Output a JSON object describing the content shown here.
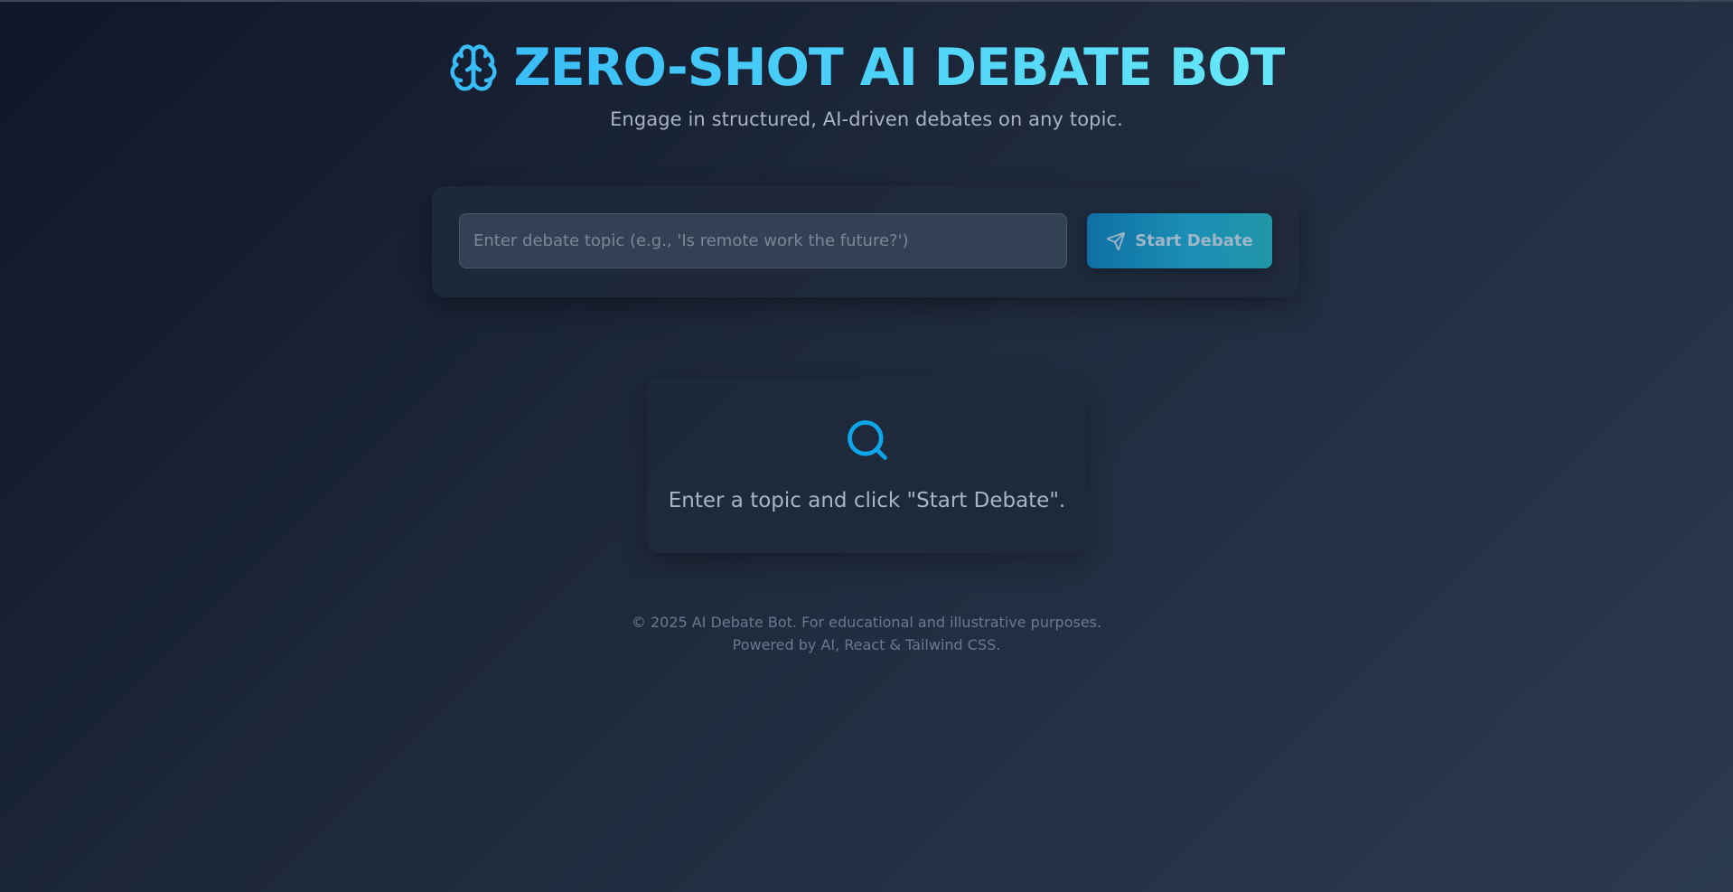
{
  "header": {
    "title": "ZERO-SHOT AI DEBATE BOT",
    "subtitle": "Engage in structured, AI-driven debates on any topic.",
    "icon": "brain-icon"
  },
  "form": {
    "topic_value": "",
    "topic_placeholder": "Enter debate topic (e.g., 'Is remote work the future?')",
    "start_label": "Start Debate",
    "start_icon": "send-icon"
  },
  "empty_state": {
    "icon": "search-icon",
    "message": "Enter a topic and click \"Start Debate\"."
  },
  "footer": {
    "line1": "© 2025 AI Debate Bot. For educational and illustrative purposes.",
    "line2": "Powered by AI, React & Tailwind CSS."
  },
  "colors": {
    "accent": "#38bdf8",
    "accent_light": "#67e8f9",
    "background_dark": "#0f172a",
    "card": "#1e293b",
    "input": "#334155",
    "button_start": "#0f6fa3",
    "button_end": "#2196a8",
    "muted_text": "#a8b3c4"
  }
}
